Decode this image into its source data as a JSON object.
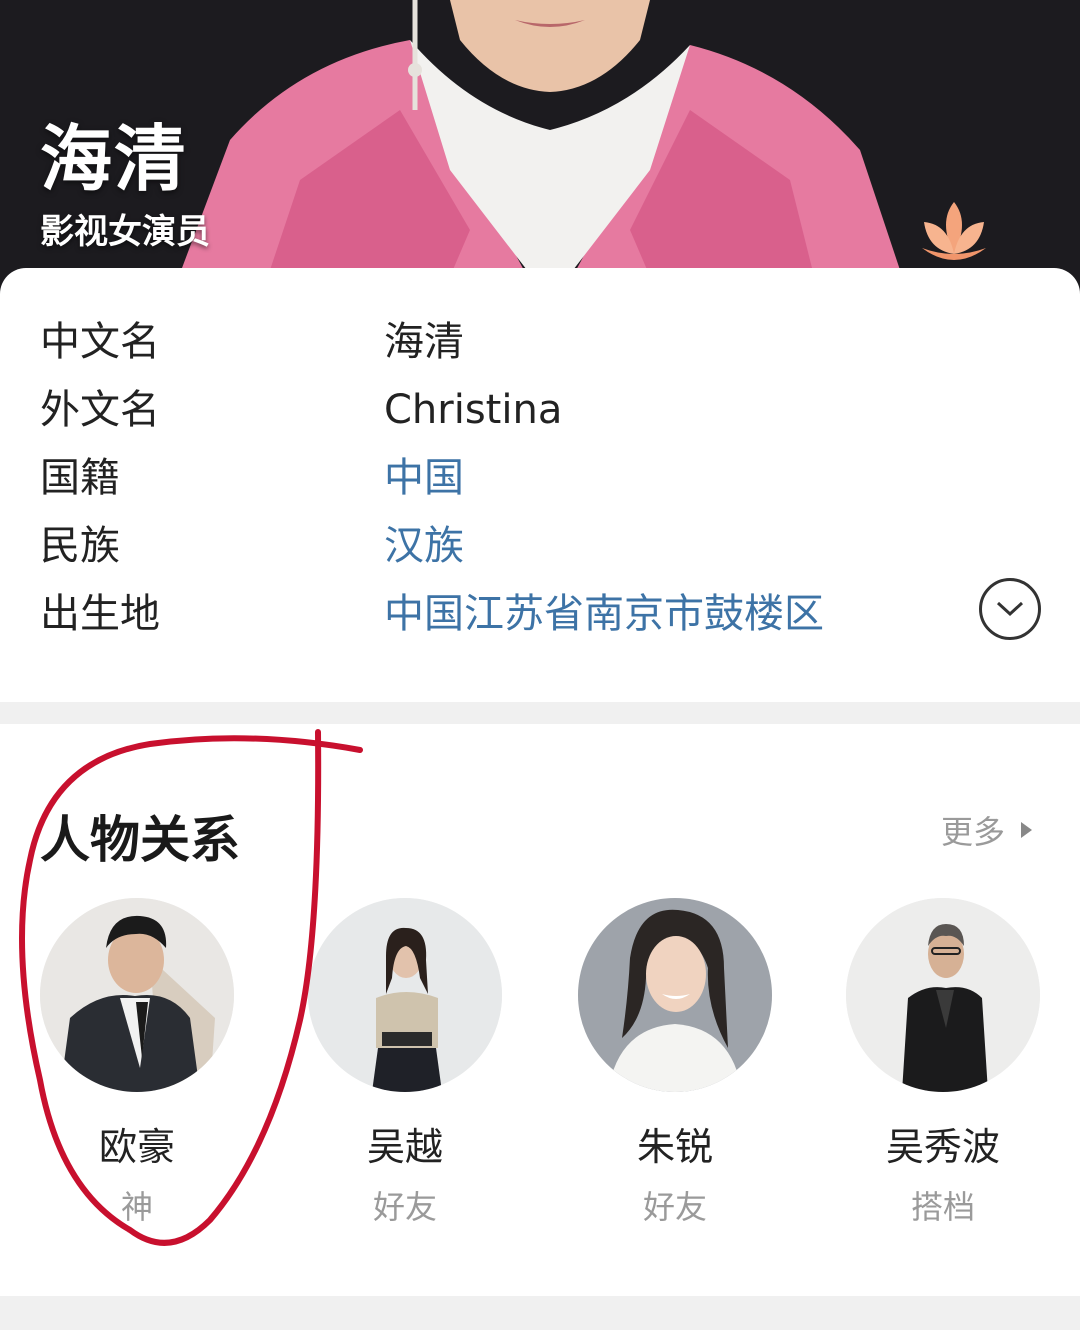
{
  "profile": {
    "name": "海清",
    "title": "影视女演员"
  },
  "info": [
    {
      "label": "中文名",
      "value": "海清",
      "link": false
    },
    {
      "label": "外文名",
      "value": "Christina",
      "link": false
    },
    {
      "label": "国籍",
      "value": "中国",
      "link": true
    },
    {
      "label": "民族",
      "value": "汉族",
      "link": true
    },
    {
      "label": "出生地",
      "value": "中国江苏省南京市鼓楼区",
      "link": true
    }
  ],
  "relations": {
    "title": "人物关系",
    "more_label": "更多",
    "people": [
      {
        "name": "欧豪",
        "relation": "神"
      },
      {
        "name": "吴越",
        "relation": "好友"
      },
      {
        "name": "朱锐",
        "relation": "好友"
      },
      {
        "name": "吴秀波",
        "relation": "搭档"
      }
    ]
  },
  "colors": {
    "link": "#3d73a6",
    "annotation_red": "#c8102e",
    "jacket_pink": "#e8799f"
  },
  "icons": {
    "expand": "chevron-down-circle-icon",
    "more": "triangle-right-icon",
    "decoration": "lotus-icon"
  }
}
